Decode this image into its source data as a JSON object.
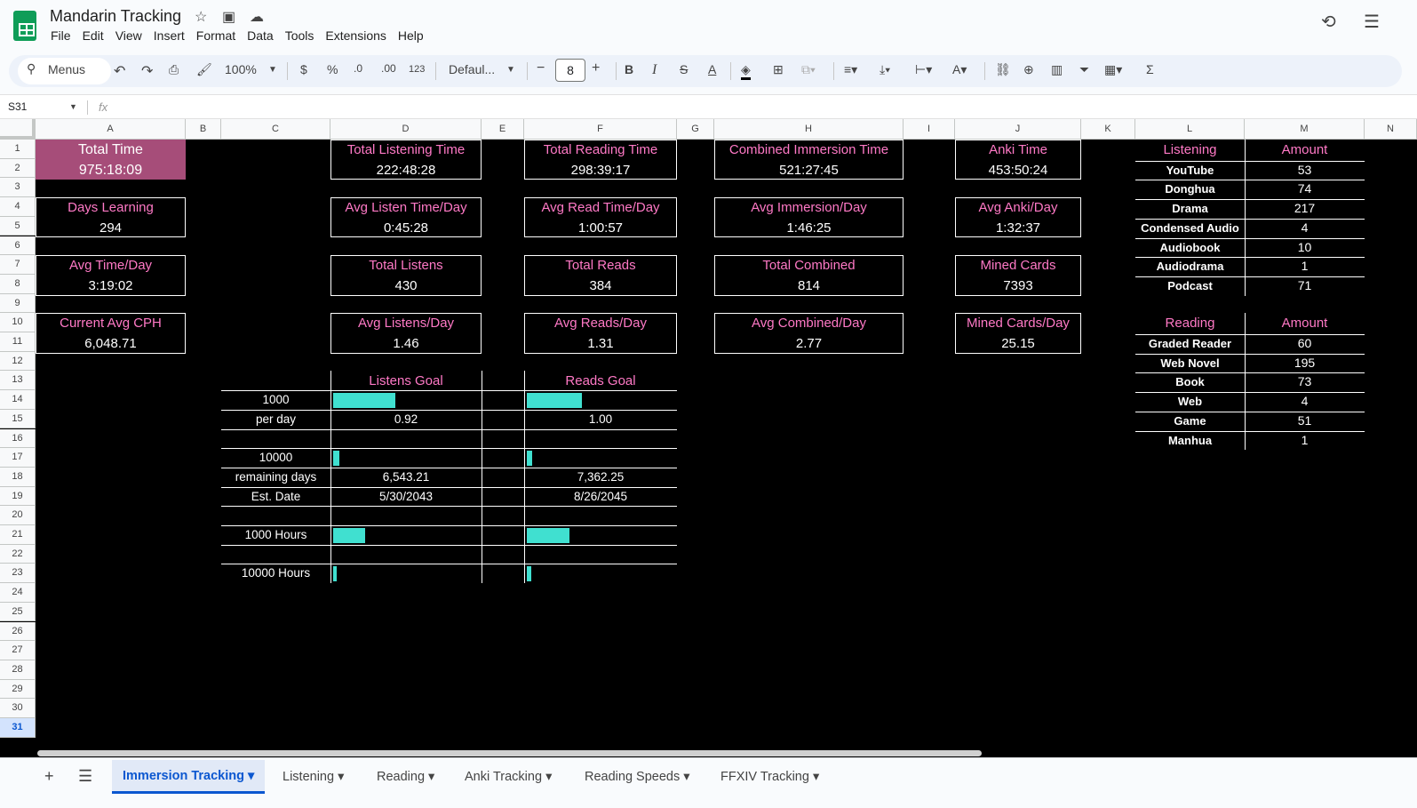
{
  "app": {
    "title": "Mandarin Tracking",
    "menu": [
      "File",
      "Edit",
      "View",
      "Insert",
      "Format",
      "Data",
      "Tools",
      "Extensions",
      "Help"
    ]
  },
  "toolbar": {
    "search": "Menus",
    "zoom": "100%",
    "currency": "$",
    "percent": "%",
    "dec_dec": ".0",
    "inc_dec": ".00",
    "number_format": "123",
    "font": "Defaul...",
    "font_size": "8"
  },
  "formula_bar": {
    "cell_ref": "S31",
    "fx": "fx",
    "value": ""
  },
  "columns": [
    "A",
    "B",
    "C",
    "D",
    "E",
    "F",
    "G",
    "H",
    "I",
    "J",
    "K",
    "L",
    "M",
    "N"
  ],
  "rows": [
    "1",
    "2",
    "3",
    "4",
    "5",
    "6",
    "7",
    "8",
    "9",
    "10",
    "11",
    "12",
    "13",
    "14",
    "15",
    "16",
    "17",
    "18",
    "19",
    "20",
    "21",
    "22",
    "23",
    "24",
    "25",
    "26",
    "27",
    "28",
    "29",
    "30",
    "31"
  ],
  "stats": {
    "total_time": {
      "label": "Total Time",
      "value": "975:18:09"
    },
    "total_listening": {
      "label": "Total Listening Time",
      "value": "222:48:28"
    },
    "total_reading": {
      "label": "Total Reading Time",
      "value": "298:39:17"
    },
    "combined_immersion": {
      "label": "Combined Immersion Time",
      "value": "521:27:45"
    },
    "anki_time": {
      "label": "Anki Time",
      "value": "453:50:24"
    },
    "days_learning": {
      "label": "Days Learning",
      "value": "294"
    },
    "avg_listen_day": {
      "label": "Avg Listen Time/Day",
      "value": "0:45:28"
    },
    "avg_read_day": {
      "label": "Avg Read Time/Day",
      "value": "1:00:57"
    },
    "avg_immersion_day": {
      "label": "Avg Immersion/Day",
      "value": "1:46:25"
    },
    "avg_anki_day": {
      "label": "Avg Anki/Day",
      "value": "1:32:37"
    },
    "avg_time_day": {
      "label": "Avg Time/Day",
      "value": "3:19:02"
    },
    "total_listens": {
      "label": "Total Listens",
      "value": "430"
    },
    "total_reads": {
      "label": "Total Reads",
      "value": "384"
    },
    "total_combined": {
      "label": "Total Combined",
      "value": "814"
    },
    "mined_cards": {
      "label": "Mined Cards",
      "value": "7393"
    },
    "current_avg_cph": {
      "label": "Current Avg CPH",
      "value": "6,048.71"
    },
    "avg_listens_day": {
      "label": "Avg Listens/Day",
      "value": "1.46"
    },
    "avg_reads_day": {
      "label": "Avg Reads/Day",
      "value": "1.31"
    },
    "avg_combined_day": {
      "label": "Avg Combined/Day",
      "value": "2.77"
    },
    "mined_cards_day": {
      "label": "Mined Cards/Day",
      "value": "25.15"
    }
  },
  "goals": {
    "listens_header": "Listens Goal",
    "reads_header": "Reads Goal",
    "rows": [
      {
        "label": "1000",
        "listens_progress": 0.43,
        "reads_progress": 0.384
      },
      {
        "label": "per day",
        "listens": "0.92",
        "reads": "1.00"
      },
      {
        "label": "10000",
        "listens_progress": 0.043,
        "reads_progress": 0.0384
      },
      {
        "label": "remaining days",
        "listens": "6,543.21",
        "reads": "7,362.25"
      },
      {
        "label": "Est. Date",
        "listens": "5/30/2043",
        "reads": "8/26/2045"
      },
      {
        "label": "1000 Hours",
        "listens_progress": 0.223,
        "reads_progress": 0.299
      },
      {
        "label": "10000 Hours",
        "listens_progress": 0.0223,
        "reads_progress": 0.0299
      }
    ]
  },
  "listening": {
    "header": "Listening",
    "amount_header": "Amount",
    "items": [
      {
        "name": "YouTube",
        "amount": "53"
      },
      {
        "name": "Donghua",
        "amount": "74"
      },
      {
        "name": "Drama",
        "amount": "217"
      },
      {
        "name": "Condensed Audio",
        "amount": "4"
      },
      {
        "name": "Audiobook",
        "amount": "10"
      },
      {
        "name": "Audiodrama",
        "amount": "1"
      },
      {
        "name": "Podcast",
        "amount": "71"
      }
    ]
  },
  "reading": {
    "header": "Reading",
    "amount_header": "Amount",
    "items": [
      {
        "name": "Graded Reader",
        "amount": "60"
      },
      {
        "name": "Web Novel",
        "amount": "195"
      },
      {
        "name": "Book",
        "amount": "73"
      },
      {
        "name": "Web",
        "amount": "4"
      },
      {
        "name": "Game",
        "amount": "51"
      },
      {
        "name": "Manhua",
        "amount": "1"
      }
    ]
  },
  "sheet_tabs": [
    "Immersion Tracking",
    "Listening",
    "Reading",
    "Anki Tracking",
    "Reading Speeds",
    "FFXIV Tracking"
  ],
  "colors": {
    "label_pink": "#ff79c6",
    "progress": "#40e0d0",
    "total_time_bg": "#a64d79",
    "background": "#000000"
  }
}
